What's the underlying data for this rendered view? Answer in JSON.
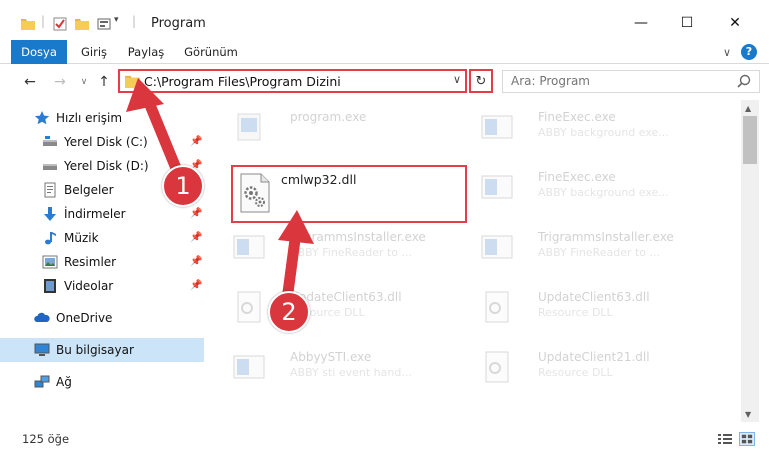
{
  "window": {
    "title": "Program",
    "minimize": "—",
    "maximize": "☐",
    "close": "✕"
  },
  "ribbon": {
    "tabs": [
      "Dosya",
      "Giriş",
      "Paylaş",
      "Görünüm"
    ],
    "expand_chevron": "∨",
    "help": "?"
  },
  "nav": {
    "back": "←",
    "forward": "→",
    "recent": "∨",
    "up": "↑",
    "address": "C:\\Program Files\\Program Dizini",
    "address_chevron": "∨",
    "refresh": "↻",
    "search_placeholder": "Ara: Program"
  },
  "sidebar": {
    "quick_access": "Hızlı erişim",
    "items": [
      {
        "label": "Yerel Disk (C:)",
        "icon": "drive-icon"
      },
      {
        "label": "Yerel Disk (D:)",
        "icon": "drive-icon"
      },
      {
        "label": "Belgeler",
        "icon": "documents-icon"
      },
      {
        "label": "İndirmeler",
        "icon": "downloads-icon"
      },
      {
        "label": "Müzik",
        "icon": "music-icon"
      },
      {
        "label": "Resimler",
        "icon": "pictures-icon"
      },
      {
        "label": "Videolar",
        "icon": "videos-icon"
      }
    ],
    "onedrive": "OneDrive",
    "this_pc": "Bu bilgisayar",
    "network": "Ağ"
  },
  "files": {
    "left": [
      {
        "name": "program.exe",
        "desc": ""
      },
      {
        "name": "TrigrammsInstaller.exe",
        "desc": "ABBY FineReader to ..."
      },
      {
        "name": "UpdateClient63.dll",
        "desc": "Resource DLL"
      },
      {
        "name": "AbbyySTI.exe",
        "desc": "ABBY sti event hand..."
      }
    ],
    "right": [
      {
        "name": "FineExec.exe",
        "desc": "ABBY background exe..."
      },
      {
        "name": "FineExec.exe",
        "desc": "ABBY background exe..."
      },
      {
        "name": "TrigrammsInstaller.exe",
        "desc": "ABBY FineReader to ..."
      },
      {
        "name": "UpdateClient63.dll",
        "desc": "Resource DLL"
      },
      {
        "name": "UpdateClient21.dll",
        "desc": "Resource DLL"
      }
    ],
    "selected": {
      "name": "cmlwp32.dll"
    }
  },
  "status": {
    "count": "125 öğe"
  },
  "annotations": {
    "badge1": "1",
    "badge2": "2",
    "arrow_color": "#d9363e"
  }
}
